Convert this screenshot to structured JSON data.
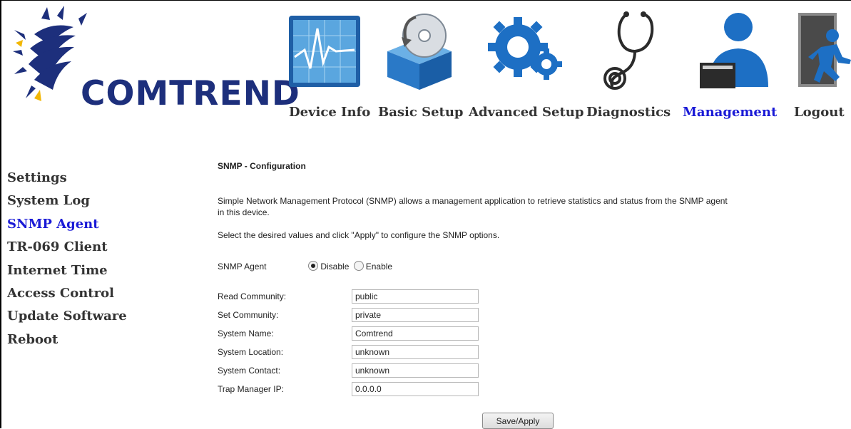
{
  "brand": {
    "logo_text": "COMTREND"
  },
  "nav": {
    "items": [
      {
        "label": "Device Info",
        "icon": "chart-monitor-icon"
      },
      {
        "label": "Basic Setup",
        "icon": "disc-box-icon"
      },
      {
        "label": "Advanced Setup",
        "icon": "gears-icon"
      },
      {
        "label": "Diagnostics",
        "icon": "stethoscope-icon"
      },
      {
        "label": "Management",
        "icon": "user-laptop-icon",
        "active": true
      },
      {
        "label": "Logout",
        "icon": "exit-door-icon"
      }
    ]
  },
  "sidebar": {
    "items": [
      {
        "label": "Settings"
      },
      {
        "label": "System Log"
      },
      {
        "label": "SNMP Agent",
        "active": true
      },
      {
        "label": "TR-069 Client"
      },
      {
        "label": "Internet Time"
      },
      {
        "label": "Access Control"
      },
      {
        "label": "Update Software"
      },
      {
        "label": "Reboot"
      }
    ]
  },
  "main": {
    "title": "SNMP - Configuration",
    "description_line1": "Simple Network Management Protocol (SNMP) allows a management application to retrieve statistics and status from the SNMP agent",
    "description_line2": "in this device.",
    "instruction": "Select the desired values and click \"Apply\" to configure the SNMP options.",
    "snmp_agent": {
      "label": "SNMP Agent",
      "options": [
        "Disable",
        "Enable"
      ],
      "selected": "Disable"
    },
    "fields": [
      {
        "label": "Read Community:",
        "value": "public"
      },
      {
        "label": "Set Community:",
        "value": "private"
      },
      {
        "label": "System Name:",
        "value": "Comtrend"
      },
      {
        "label": "System Location:",
        "value": "unknown"
      },
      {
        "label": "System Contact:",
        "value": "unknown"
      },
      {
        "label": "Trap Manager IP:",
        "value": "0.0.0.0"
      }
    ],
    "save_label": "Save/Apply"
  },
  "colors": {
    "brand": "#1d2f7c",
    "active_link": "#1a1ad6",
    "inactive_link": "#333333"
  }
}
